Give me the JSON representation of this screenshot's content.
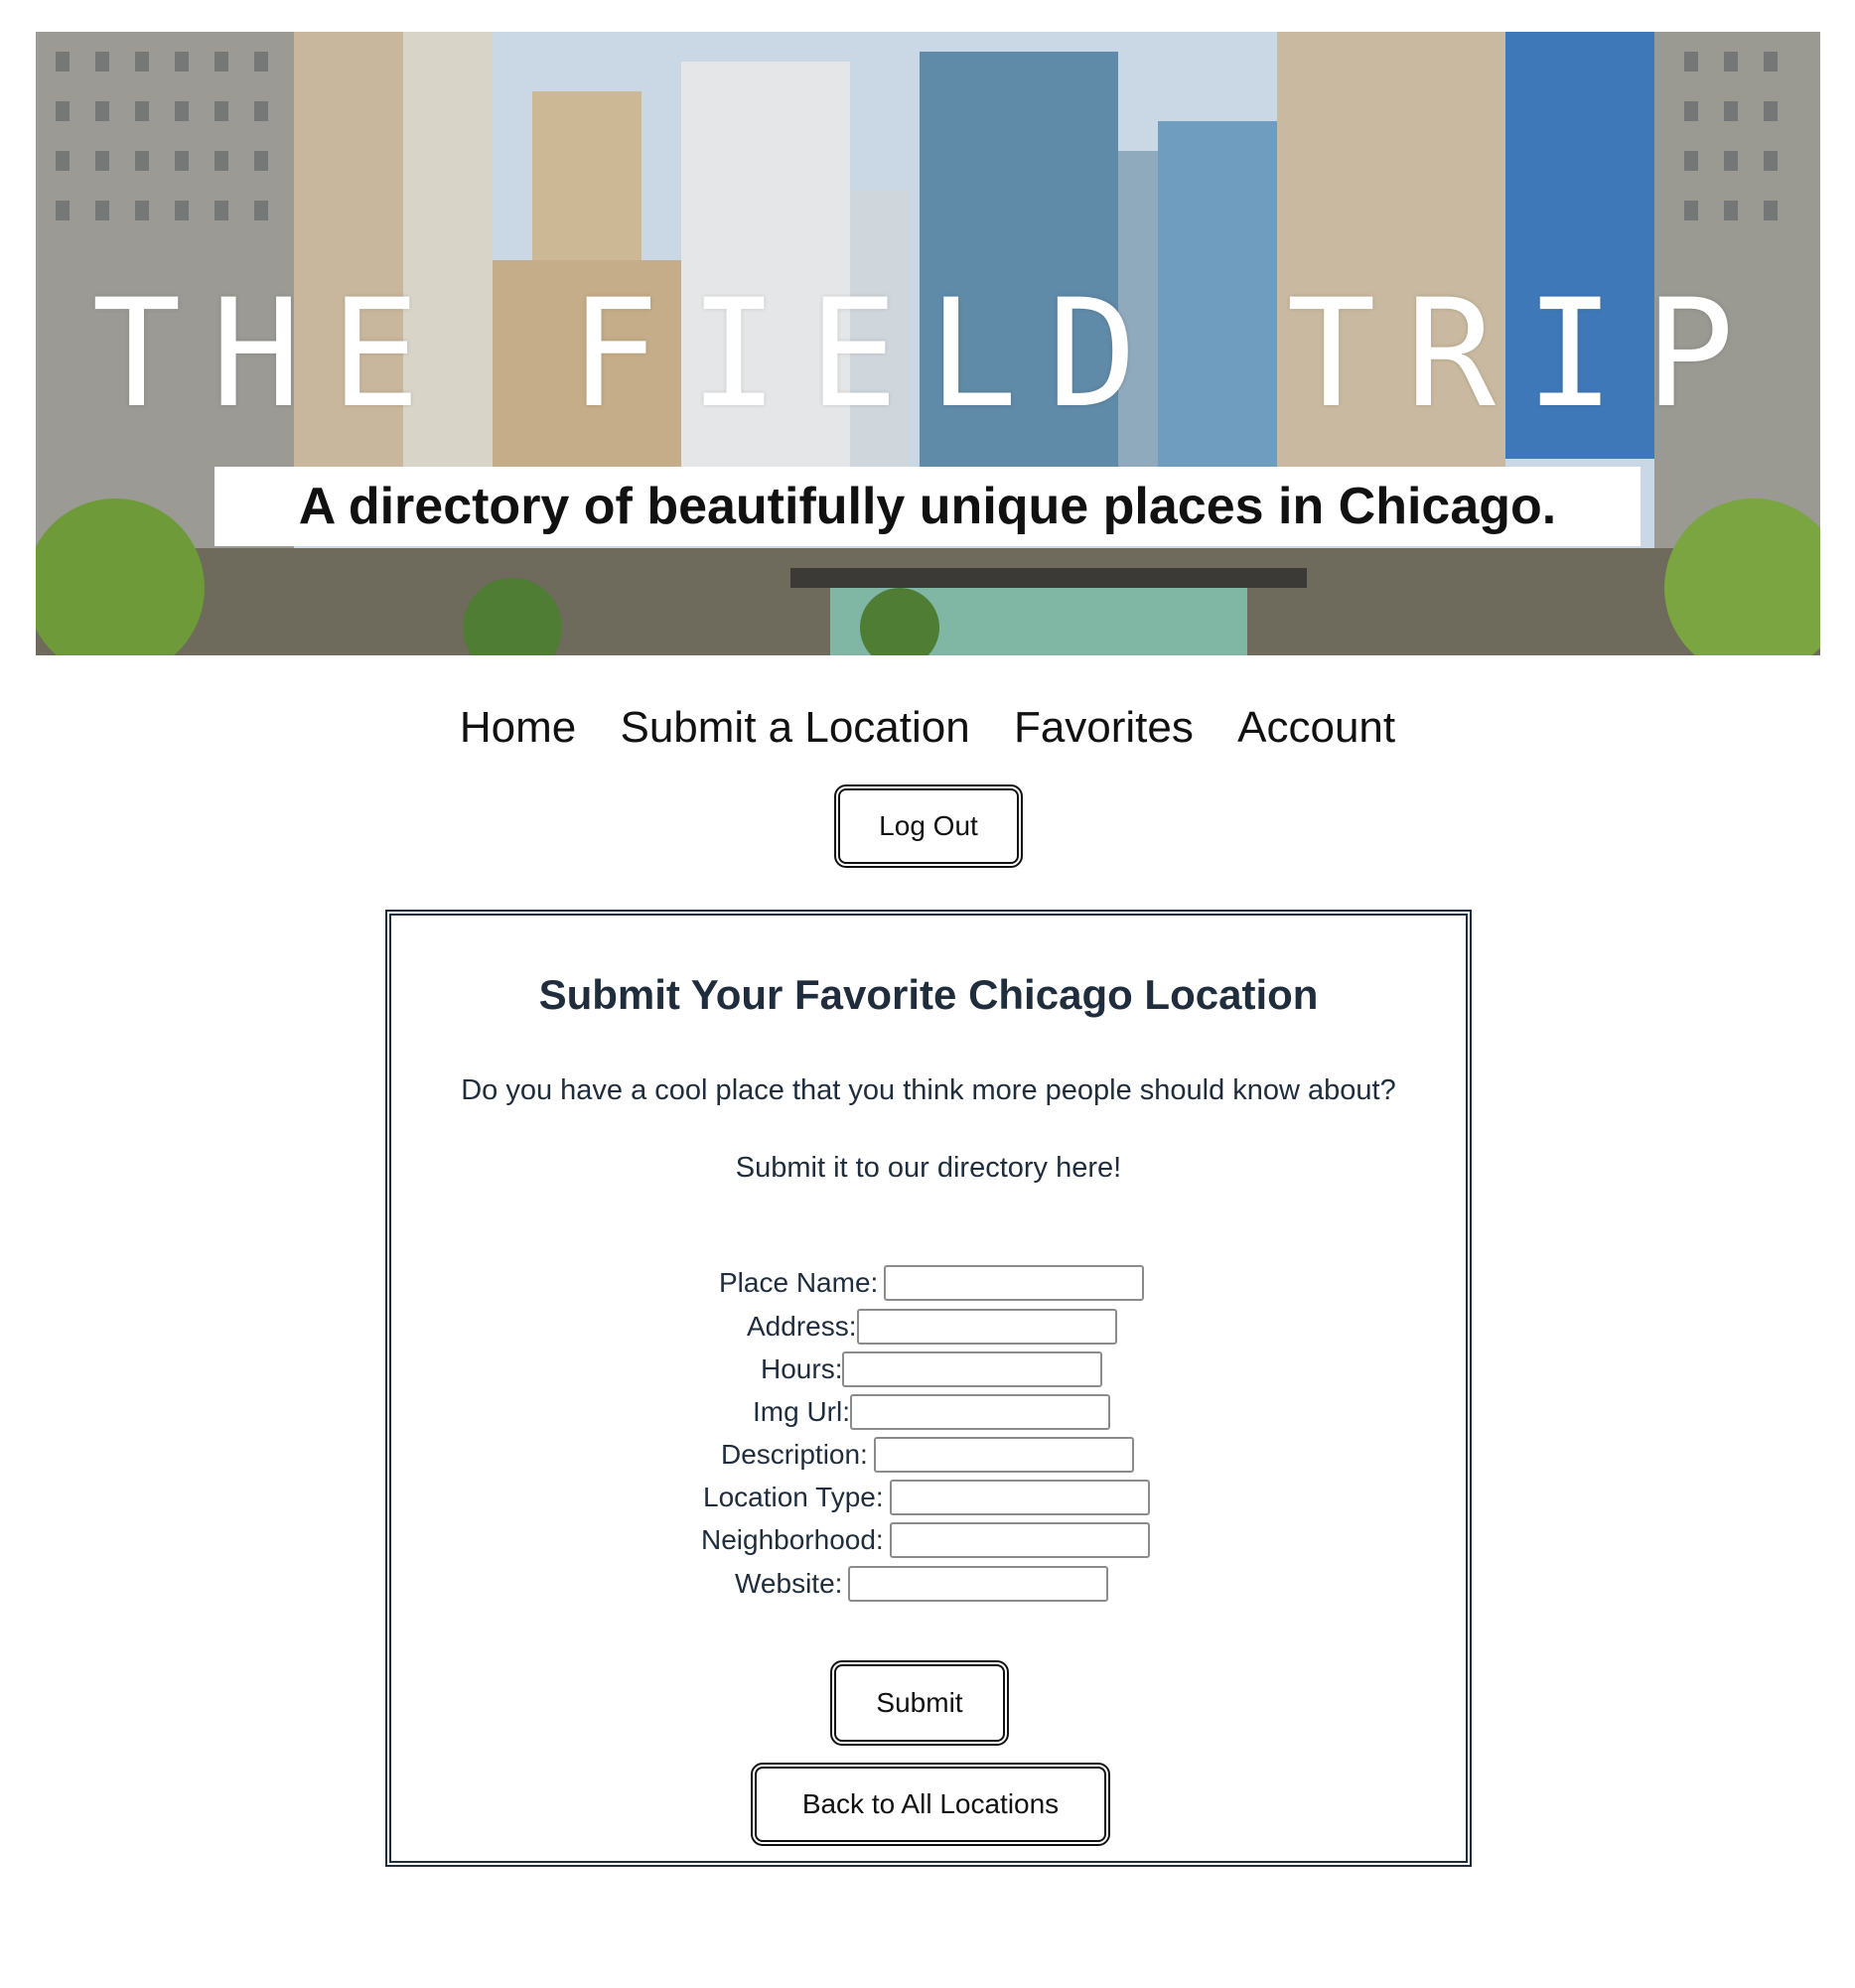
{
  "hero": {
    "title": "THE FIELD TRIP",
    "subtitle": "A directory of beautifully unique places in Chicago."
  },
  "nav": {
    "items": [
      "Home",
      "Submit a Location",
      "Favorites",
      "Account"
    ],
    "logout_label": "Log Out"
  },
  "form": {
    "title": "Submit Your Favorite Chicago Location",
    "intro": "Do you have a cool place that you think more people should know about?",
    "cta": "Submit it to our directory here!",
    "fields": [
      {
        "label": "Place Name:",
        "value": ""
      },
      {
        "label": "Address:",
        "value": ""
      },
      {
        "label": "Hours:",
        "value": ""
      },
      {
        "label": "Img Url:",
        "value": ""
      },
      {
        "label": "Description:",
        "value": ""
      },
      {
        "label": "Location Type:",
        "value": ""
      },
      {
        "label": "Neighborhood:",
        "value": ""
      },
      {
        "label": "Website:",
        "value": ""
      }
    ],
    "submit_label": "Submit",
    "back_label": "Back to All Locations"
  },
  "colors": {
    "text_dark": "#1f2d3d",
    "card_border": "#1f2d3d",
    "button_border": "#111111"
  }
}
